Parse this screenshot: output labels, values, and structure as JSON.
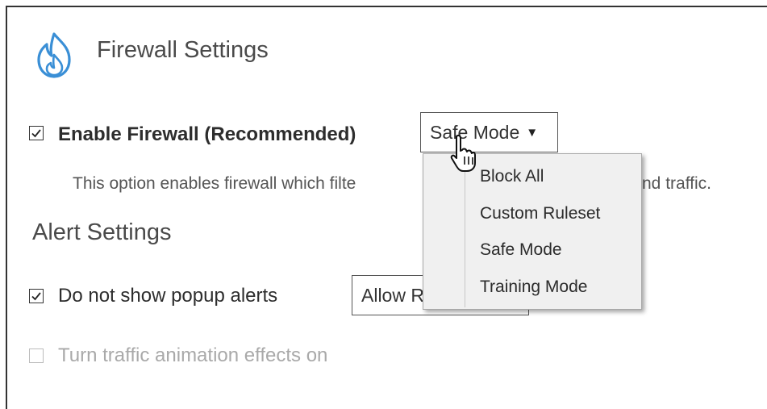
{
  "header": {
    "title": "Firewall Settings",
    "icon": "firewall-flame-icon"
  },
  "firewall": {
    "enable_label": "Enable Firewall (Recommended)",
    "enabled": true,
    "mode_selected": "Safe Mode",
    "description_visible_left": "This option enables firewall which filte",
    "description_visible_right": "nd traffic."
  },
  "mode_menu": {
    "items": [
      {
        "label": "Block All"
      },
      {
        "label": "Custom Ruleset"
      },
      {
        "label": "Safe Mode"
      },
      {
        "label": "Training Mode"
      }
    ]
  },
  "alerts": {
    "section_title": "Alert Settings",
    "popup_label": "Do not show popup alerts",
    "popup_checked": true,
    "popup_select_value": "Allow R"
  },
  "animation": {
    "label": "Turn traffic animation effects on",
    "checked": false
  },
  "colors": {
    "accent_blue": "#3a8fd6"
  }
}
